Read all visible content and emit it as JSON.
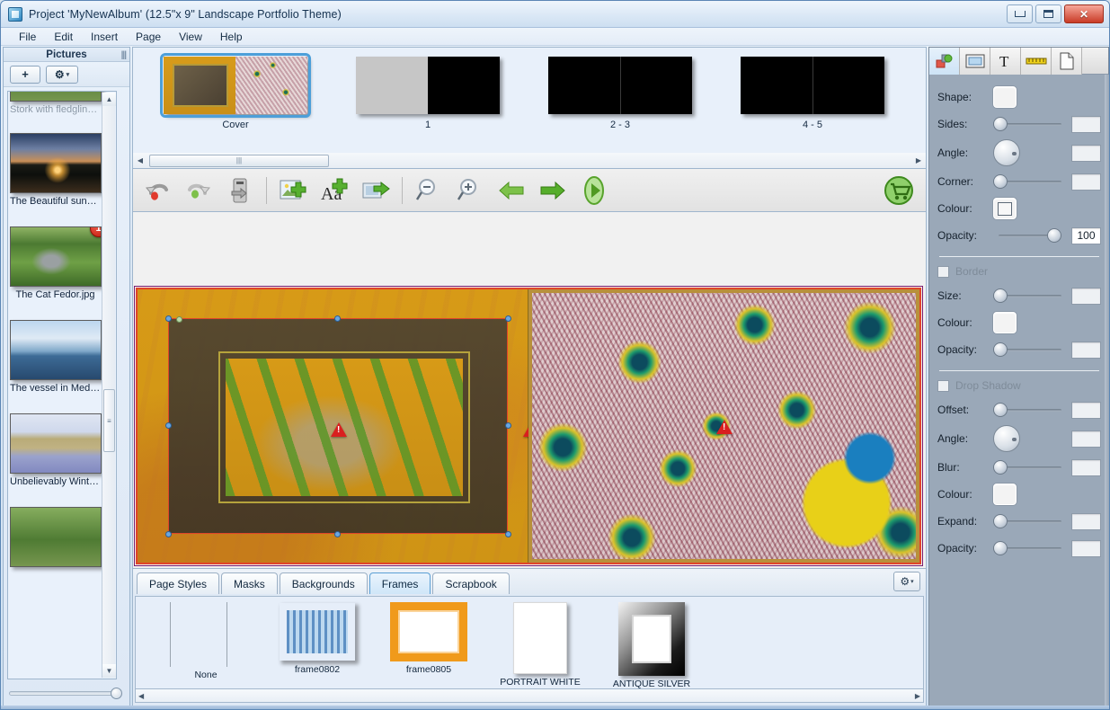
{
  "window": {
    "title": "Project 'MyNewAlbum' (12.5\"x 9\" Landscape Portfolio Theme)",
    "icon": "album-icon",
    "minimize_label": "Minimize",
    "maximize_label": "Maximize",
    "close_label": "✕"
  },
  "menu": {
    "items": [
      {
        "label": "File"
      },
      {
        "label": "Edit"
      },
      {
        "label": "Insert"
      },
      {
        "label": "Page"
      },
      {
        "label": "View"
      },
      {
        "label": "Help"
      }
    ]
  },
  "sidebar": {
    "title": "Pictures",
    "add_label": "+",
    "gear_label": "⚙",
    "gear_caret": "▾",
    "pictures": [
      {
        "label": "Stork with fledglings...",
        "thumb": "th-green",
        "badge": null
      },
      {
        "label": "The Beautiful sunse...",
        "thumb": "th-sunset",
        "badge": null
      },
      {
        "label": "The Cat Fedor.jpg",
        "thumb": "th-cat",
        "badge": "1"
      },
      {
        "label": "The vessel in Medite...",
        "thumb": "th-vessel",
        "badge": null
      },
      {
        "label": "Unbelievably Winter....",
        "thumb": "th-winter",
        "badge": null
      },
      {
        "label": "",
        "thumb": "th-green",
        "badge": null
      }
    ],
    "zoom_slider_value": 100,
    "scroll_up": "▲",
    "scroll_down": "▼"
  },
  "pagestrip": {
    "pages": [
      {
        "caption": "Cover",
        "kind": "cover",
        "selected": true
      },
      {
        "caption": "1",
        "kind": "half",
        "selected": false
      },
      {
        "caption": "2 - 3",
        "kind": "black",
        "selected": false
      },
      {
        "caption": "4 - 5",
        "kind": "black",
        "selected": false
      }
    ],
    "scroll_left": "◀",
    "scroll_right": "▶"
  },
  "toolbar": {
    "buttons": [
      {
        "name": "undo-icon",
        "label": "Undo"
      },
      {
        "name": "redo-icon",
        "label": "Redo"
      },
      {
        "name": "save-icon",
        "label": "Save"
      },
      {
        "name": "add-picture-icon",
        "label": "Add Picture"
      },
      {
        "name": "add-text-icon",
        "label": "Add Text"
      },
      {
        "name": "add-page-icon",
        "label": "Add Page"
      },
      {
        "name": "zoom-out-icon",
        "label": "Zoom Out"
      },
      {
        "name": "zoom-in-icon",
        "label": "Zoom In"
      },
      {
        "name": "previous-page-icon",
        "label": "Previous Page"
      },
      {
        "name": "next-page-icon",
        "label": "Next Page"
      },
      {
        "name": "preview-icon",
        "label": "Preview"
      }
    ],
    "cart_label": "Buy / Order"
  },
  "canvas": {
    "warnings": [
      {
        "id": "warn-left-object"
      },
      {
        "id": "warn-gutter"
      },
      {
        "id": "warn-right-page"
      }
    ],
    "selected_object": "framed-photo"
  },
  "bottom_tabs": {
    "tabs": [
      {
        "label": "Page Styles",
        "active": false
      },
      {
        "label": "Masks",
        "active": false
      },
      {
        "label": "Backgrounds",
        "active": false
      },
      {
        "label": "Frames",
        "active": true
      },
      {
        "label": "Scrapbook",
        "active": false
      }
    ],
    "gear_label": "⚙",
    "gear_caret": "▾",
    "frames": [
      {
        "label": "None",
        "kind": "none"
      },
      {
        "label": "frame0802",
        "kind": "blue"
      },
      {
        "label": "frame0805",
        "kind": "orange"
      },
      {
        "label": "PORTRAIT WHITE",
        "kind": "portrait-white"
      },
      {
        "label": "ANTIQUE SILVER",
        "kind": "antique-silver"
      }
    ],
    "scroll_left": "◀",
    "scroll_right": "▶"
  },
  "properties": {
    "tabs": [
      {
        "name": "shape-tab",
        "glyph": "objects",
        "active": true
      },
      {
        "name": "frame-tab",
        "glyph": "frame",
        "active": false
      },
      {
        "name": "text-tab",
        "glyph": "T",
        "active": false
      },
      {
        "name": "ruler-tab",
        "glyph": "ruler",
        "active": false
      },
      {
        "name": "page-tab",
        "glyph": "page",
        "active": false
      }
    ],
    "main": [
      {
        "label": "Shape:",
        "control": "swatch",
        "value": ""
      },
      {
        "label": "Sides:",
        "control": "slider",
        "value": ""
      },
      {
        "label": "Angle:",
        "control": "dial",
        "value": ""
      },
      {
        "label": "Corner:",
        "control": "slider",
        "value": ""
      },
      {
        "label": "Colour:",
        "control": "swatch-inner",
        "value": ""
      },
      {
        "label": "Opacity:",
        "control": "slider-full",
        "value": "100"
      }
    ],
    "border": {
      "title": "Border",
      "checked": false,
      "rows": [
        {
          "label": "Size:",
          "control": "slider",
          "value": ""
        },
        {
          "label": "Colour:",
          "control": "swatch",
          "value": ""
        },
        {
          "label": "Opacity:",
          "control": "slider",
          "value": ""
        }
      ]
    },
    "drop_shadow": {
      "title": "Drop Shadow",
      "checked": false,
      "rows": [
        {
          "label": "Offset:",
          "control": "slider",
          "value": ""
        },
        {
          "label": "Angle:",
          "control": "dial",
          "value": ""
        },
        {
          "label": "Blur:",
          "control": "slider",
          "value": ""
        },
        {
          "label": "Colour:",
          "control": "swatch",
          "value": ""
        },
        {
          "label": "Expand:",
          "control": "slider",
          "value": ""
        },
        {
          "label": "Opacity:",
          "control": "slider",
          "value": ""
        }
      ]
    }
  },
  "colors": {
    "accent": "#4d9fd9",
    "selection": "#e0452a",
    "warning": "#d91f1f",
    "panel": "#9aa8b8",
    "page_bg": "#d79a17"
  }
}
